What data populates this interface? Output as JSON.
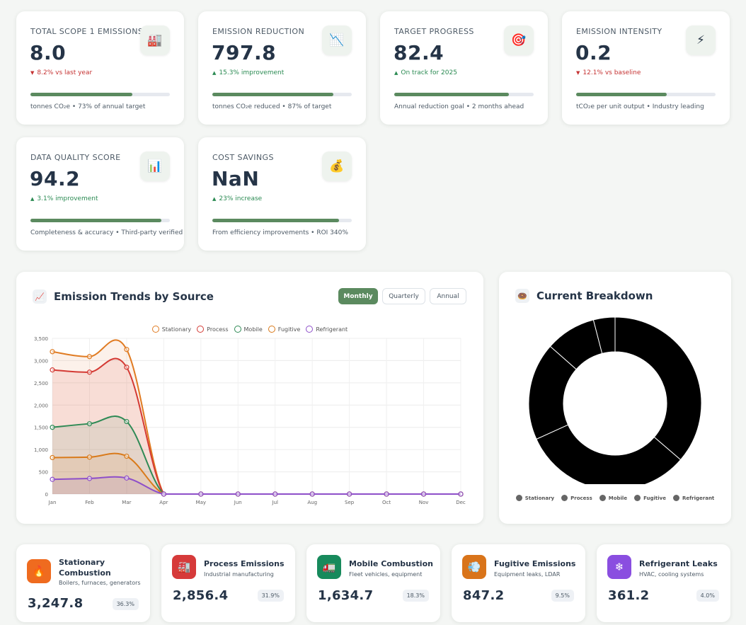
{
  "kpis": [
    {
      "label": "TOTAL SCOPE 1 EMISSIONS",
      "value": "8.0",
      "delta": "8.2% vs last year",
      "direction": "down",
      "progress": 0.73,
      "footnote": "tonnes CO₂e • 73% of annual target",
      "icon": "factory-icon",
      "glyph": "🏭"
    },
    {
      "label": "EMISSION REDUCTION",
      "value": "797.8",
      "delta": "15.3% improvement",
      "direction": "up",
      "progress": 0.87,
      "footnote": "tonnes CO₂e reduced • 87% of target",
      "icon": "chart-down-icon",
      "glyph": "📉"
    },
    {
      "label": "TARGET PROGRESS",
      "value": "82.4",
      "delta": "On track for 2025",
      "direction": "up",
      "progress": 0.82,
      "footnote": "Annual reduction goal • 2 months ahead",
      "icon": "target-icon",
      "glyph": "🎯"
    },
    {
      "label": "EMISSION INTENSITY",
      "value": "0.2",
      "delta": "12.1% vs baseline",
      "direction": "down",
      "progress": 0.65,
      "footnote": "tCO₂e per unit output • Industry leading",
      "icon": "lightning-icon",
      "glyph": "⚡"
    },
    {
      "label": "DATA QUALITY SCORE",
      "value": "94.2",
      "delta": "3.1% improvement",
      "direction": "up",
      "progress": 0.94,
      "footnote": "Completeness & accuracy • Third-party verified",
      "icon": "bar-chart-icon",
      "glyph": "📊"
    },
    {
      "label": "COST SAVINGS",
      "value": "NaN",
      "delta": "23% increase",
      "direction": "up",
      "progress": 0.91,
      "footnote": "From efficiency improvements • ROI 340%",
      "icon": "money-bag-icon",
      "glyph": "💰"
    }
  ],
  "trend_panel": {
    "title": "Emission Trends by Source",
    "icon": "line-chart-icon",
    "glyph": "📈",
    "buttons": [
      "Monthly",
      "Quarterly",
      "Annual"
    ],
    "active_button": "Monthly"
  },
  "breakdown_panel": {
    "title": "Current Breakdown",
    "icon": "pie-chart-icon",
    "glyph": "🍩",
    "legend": [
      "Stationary",
      "Process",
      "Mobile",
      "Fugitive",
      "Refrigerant"
    ]
  },
  "chart_data": [
    {
      "type": "area",
      "categories": [
        "Jan",
        "Feb",
        "Mar",
        "Apr",
        "May",
        "Jun",
        "Jul",
        "Aug",
        "Sep",
        "Oct",
        "Nov",
        "Dec"
      ],
      "ylim": [
        0,
        3500
      ],
      "yticks": [
        "0",
        "500",
        "1,000",
        "1,500",
        "2,000",
        "2,500",
        "3,000",
        "3,500"
      ],
      "grid": true,
      "legend_position": "top-center",
      "series": [
        {
          "name": "Stationary",
          "color": "#e07b22",
          "fill": "rgba(230,140,80,0.12)",
          "values": [
            3200,
            3090,
            3250,
            0,
            0,
            0,
            0,
            0,
            0,
            0,
            0,
            0
          ]
        },
        {
          "name": "Process",
          "color": "#d43a34",
          "fill": "rgba(220,80,70,0.12)",
          "values": [
            2790,
            2740,
            2850,
            0,
            0,
            0,
            0,
            0,
            0,
            0,
            0,
            0
          ]
        },
        {
          "name": "Mobile",
          "color": "#2f8a55",
          "fill": "rgba(60,140,90,0.10)",
          "values": [
            1500,
            1580,
            1630,
            0,
            0,
            0,
            0,
            0,
            0,
            0,
            0,
            0
          ]
        },
        {
          "name": "Fugitive",
          "color": "#d97a1a",
          "fill": "rgba(220,140,60,0.12)",
          "values": [
            820,
            830,
            850,
            0,
            0,
            0,
            0,
            0,
            0,
            0,
            0,
            0
          ]
        },
        {
          "name": "Refrigerant",
          "color": "#8e4fc9",
          "fill": "rgba(150,100,200,0.12)",
          "values": [
            330,
            350,
            360,
            0,
            0,
            0,
            0,
            0,
            0,
            0,
            0,
            0
          ]
        }
      ]
    },
    {
      "type": "pie",
      "labels": [
        "Stationary",
        "Process",
        "Mobile",
        "Fugitive",
        "Refrigerant"
      ],
      "values": [
        3247.8,
        2856.4,
        1634.7,
        847.2,
        361.2
      ],
      "segment_color": "#000000"
    }
  ],
  "sources": [
    {
      "title": "Stationary Combustion",
      "subtitle": "Boilers, furnaces, generators",
      "value": "3,247.8",
      "pct": "36.3%",
      "icon": "fire-icon",
      "glyph": "🔥",
      "color": "#ef6b1f"
    },
    {
      "title": "Process Emissions",
      "subtitle": "Industrial manufacturing",
      "value": "2,856.4",
      "pct": "31.9%",
      "icon": "factory-icon",
      "glyph": "🏭",
      "color": "#d63a3a"
    },
    {
      "title": "Mobile Combustion",
      "subtitle": "Fleet vehicles, equipment",
      "value": "1,634.7",
      "pct": "18.3%",
      "icon": "truck-icon",
      "glyph": "🚛",
      "color": "#178a5c"
    },
    {
      "title": "Fugitive Emissions",
      "subtitle": "Equipment leaks, LDAR",
      "value": "847.2",
      "pct": "9.5%",
      "icon": "leak-icon",
      "glyph": "💨",
      "color": "#d9741a"
    },
    {
      "title": "Refrigerant Leaks",
      "subtitle": "HVAC, cooling systems",
      "value": "361.2",
      "pct": "4.0%",
      "icon": "snowflake-icon",
      "glyph": "❄",
      "color": "#8a4ee0"
    }
  ]
}
